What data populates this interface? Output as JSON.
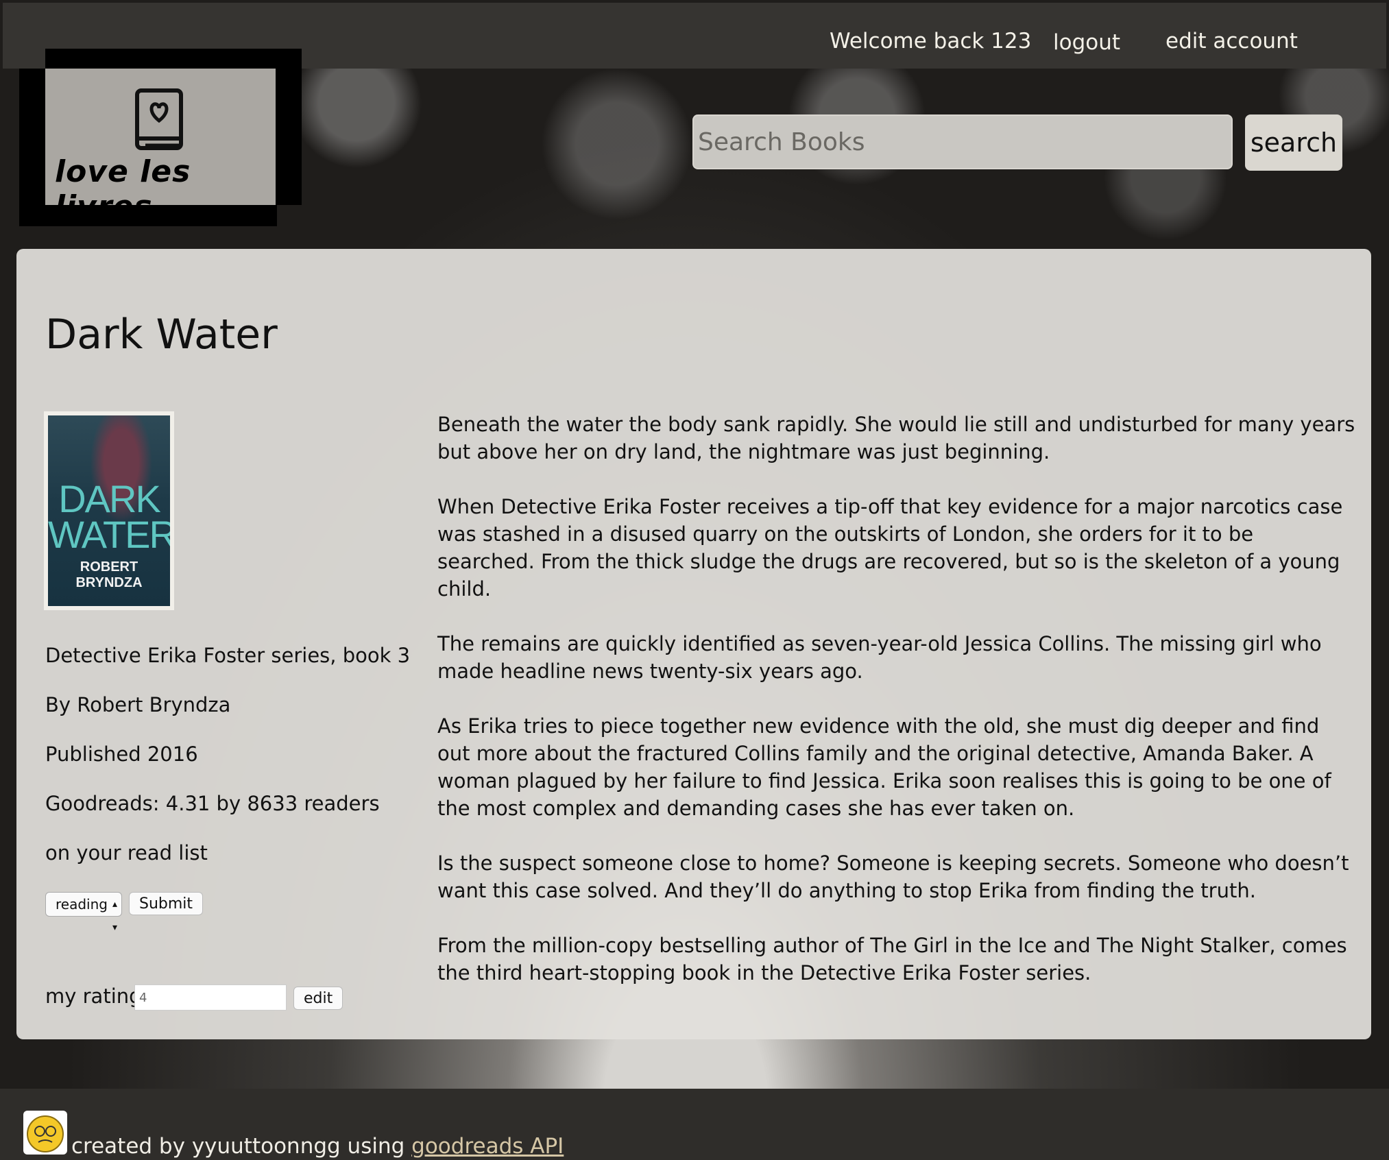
{
  "header": {
    "welcome": "Welcome back 123",
    "logout": "logout",
    "edit_account": "edit account"
  },
  "logo": {
    "text": "love les livres",
    "icon": "book-heart-icon"
  },
  "search": {
    "placeholder": "Search Books",
    "button": "search"
  },
  "book": {
    "title": "Dark Water",
    "cover_title": "DARK WATER",
    "cover_author": "ROBERT BRYNDZA",
    "series": "Detective Erika Foster series, book 3",
    "author": "By Robert Bryndza",
    "published": "Published 2016",
    "goodreads": "Goodreads: 4.31 by 8633 readers",
    "list_status": "on your read list",
    "shelf_selected": "reading",
    "submit": "Submit",
    "my_rating_label": "my rating",
    "my_rating_value": "4",
    "edit": "edit",
    "description": [
      "Beneath the water the body sank rapidly. She would lie still and undisturbed for many years but above her on dry land, the nightmare was just beginning.",
      "When Detective Erika Foster receives a tip-off that key evidence for a major narcotics case was stashed in a disused quarry on the outskirts of London, she orders for it to be searched. From the thick sludge the drugs are recovered, but so is the skeleton of a young child.",
      "The remains are quickly identified as seven-year-old Jessica Collins. The missing girl who made headline news twenty-six years ago.",
      "As Erika tries to piece together new evidence with the old, she must dig deeper and find out more about the fractured Collins family and the original detective, Amanda Baker. A woman plagued by her failure to find Jessica. Erika soon realises this is going to be one of the most complex and demanding cases she has ever taken on.",
      "Is the suspect someone close to home? Someone is keeping secrets. Someone who doesn’t want this case solved. And they’ll do anything to stop Erika from finding the truth.",
      "From the million-copy bestselling author of The Girl in the Ice and The Night Stalker, comes the third heart-stopping book in the Detective Erika Foster series."
    ]
  },
  "footer": {
    "text": "created by yyuuttoonngg using",
    "link": "goodreads API"
  }
}
